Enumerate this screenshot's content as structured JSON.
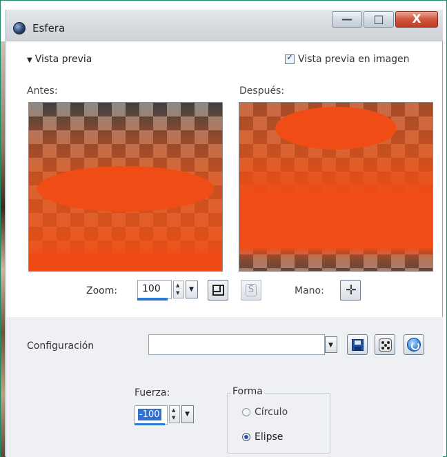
{
  "window": {
    "title": "Esfera",
    "controls": {
      "minimize": "—",
      "maximize": "□",
      "close": "X"
    }
  },
  "preview": {
    "section_label": "Vista previa",
    "show_in_image_label": "Vista previa en imagen",
    "show_in_image_checked": true,
    "before_label": "Antes:",
    "after_label": "Después:"
  },
  "zoom": {
    "label": "Zoom:",
    "value": "100",
    "hand_label": "Mano:"
  },
  "config": {
    "label": "Configuración",
    "value": ""
  },
  "params": {
    "strength_label": "Fuerza:",
    "strength_value": "-100",
    "shape_label": "Forma",
    "shape_options": [
      "Círculo",
      "Elipse"
    ],
    "shape_selected": "Elipse"
  },
  "colors": {
    "accent_orange": "#f04d16",
    "checker_dark": "#3d4143",
    "checker_light": "#8c8a86",
    "selection_blue": "#3070d0"
  },
  "icons": [
    "app-icon",
    "chevron-down-icon",
    "checkbox-icon",
    "spin-up-icon",
    "spin-down-icon",
    "fit-window-icon",
    "magnifier-icon",
    "move-icon",
    "save-icon",
    "dice-icon",
    "reset-icon"
  ]
}
